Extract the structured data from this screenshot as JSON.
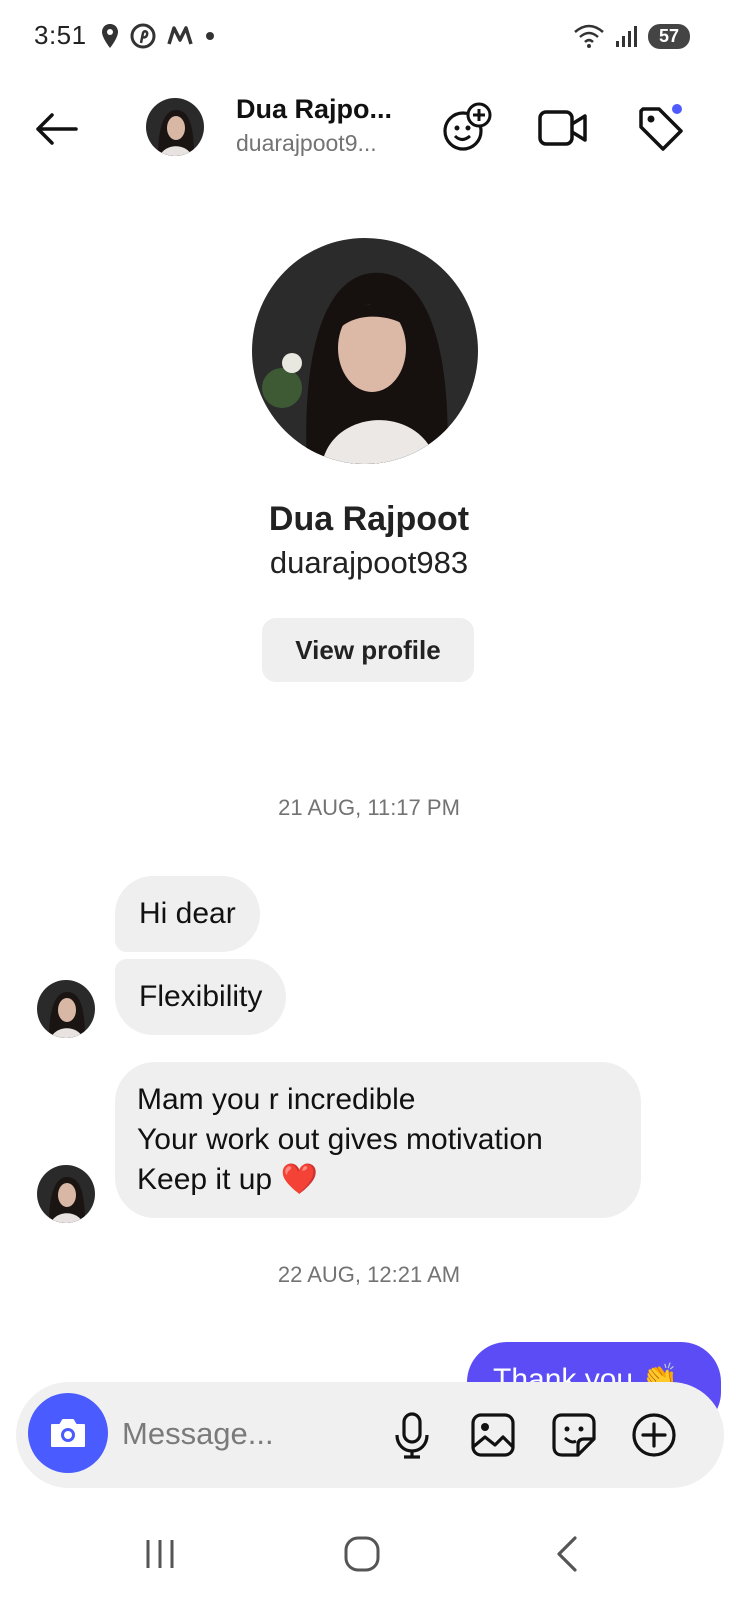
{
  "status_bar": {
    "time": "3:51",
    "battery": "57",
    "left_icons": [
      "location-pin-icon",
      "pinterest-icon",
      "m-logo-icon",
      "dot-icon"
    ],
    "right_icons": [
      "wifi-icon",
      "signal-icon",
      "battery-icon"
    ]
  },
  "header": {
    "name": "Dua Rajpo...",
    "username": "duarajpoot9...",
    "icons": [
      "back-arrow-icon",
      "add-effect-icon",
      "video-call-icon",
      "tag-icon"
    ],
    "notification_color": "#4f5bff"
  },
  "profile": {
    "name": "Dua Rajpoot",
    "username": "duarajpoot983",
    "view_profile_label": "View profile"
  },
  "chat": {
    "timestamps": [
      "21 AUG, 11:17 PM",
      "22 AUG, 12:21 AM"
    ],
    "received": [
      {
        "text": "Hi dear"
      },
      {
        "text": "Flexibility"
      },
      {
        "lines": [
          "Mam you r incredible",
          "Your work out gives motivation",
          "Keep it up ❤️"
        ]
      }
    ],
    "sent": [
      {
        "text": "Thank you 👏"
      }
    ],
    "sent_color": "#5b4cf5"
  },
  "composer": {
    "placeholder": "Message...",
    "icons": [
      "camera-icon",
      "microphone-icon",
      "gallery-icon",
      "sticker-icon",
      "plus-circle-icon"
    ],
    "camera_color": "#4a5bff"
  },
  "nav_bar": {
    "icons": [
      "recent-apps-icon",
      "home-icon",
      "back-icon"
    ]
  }
}
